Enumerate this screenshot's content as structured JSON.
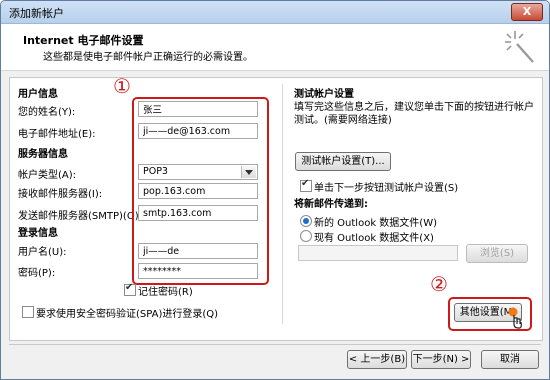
{
  "window": {
    "title": "添加新帐户",
    "close_label": "X"
  },
  "header": {
    "title": "Internet 电子邮件设置",
    "subtitle": "这些都是使电子邮件帐户正确运行的必需设置。"
  },
  "user_info": {
    "section_title": "用户信息",
    "name_label": "您的姓名(Y):",
    "name_value": "张三",
    "email_label": "电子邮件地址(E):",
    "email_value": "ji——de@163.com"
  },
  "server_info": {
    "section_title": "服务器信息",
    "account_type_label": "帐户类型(A):",
    "account_type_value": "POP3",
    "incoming_label": "接收邮件服务器(I):",
    "incoming_value": "pop.163.com",
    "outgoing_label": "发送邮件服务器(SMTP)(O):",
    "outgoing_value": "smtp.163.com"
  },
  "login_info": {
    "section_title": "登录信息",
    "username_label": "用户名(U):",
    "username_value": "ji——de",
    "password_label": "密码(P):",
    "password_value": "********",
    "remember_label": "记住密码(R)",
    "spa_label": "要求使用安全密码验证(SPA)进行登录(Q)"
  },
  "test_settings": {
    "section_title": "测试帐户设置",
    "description": "填写完这些信息之后，建议您单击下面的按钮进行帐户测试。(需要网络连接)",
    "test_button": "测试帐户设置(T)...",
    "auto_test_label": "单击下一步按钮测试帐户设置(S)",
    "deliver_title": "将新邮件传递到:",
    "new_datafile_label": "新的 Outlook 数据文件(W)",
    "existing_datafile_label": "现有 Outlook 数据文件(X)",
    "browse_button": "浏览(S)",
    "more_settings_button": "其他设置(M)"
  },
  "annotations": {
    "badge_1": "①",
    "badge_2": "②"
  },
  "footer": {
    "back_button": "< 上一步(B)",
    "next_button": "下一步(N) >",
    "cancel_button": "取消"
  }
}
